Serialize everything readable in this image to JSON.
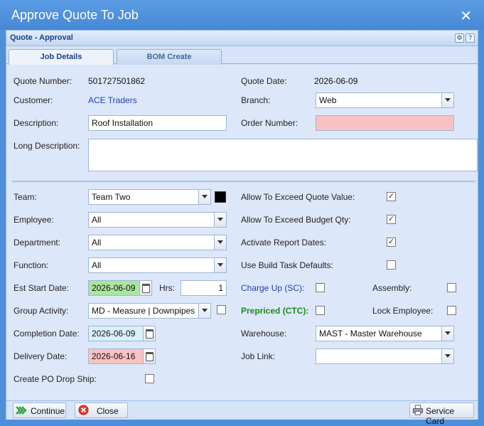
{
  "window": {
    "title": "Approve Quote To Job"
  },
  "panel": {
    "title": "Quote - Approval"
  },
  "tabs": [
    {
      "label": "Job Details"
    },
    {
      "label": "BOM Create"
    }
  ],
  "form": {
    "quote_number_label": "Quote Number:",
    "quote_number": "501727501862",
    "quote_date_label": "Quote Date:",
    "quote_date": "2026-06-09",
    "customer_label": "Customer:",
    "customer": "ACE Traders",
    "branch_label": "Branch:",
    "branch": "Web",
    "description_label": "Description:",
    "description": "Roof Installation",
    "order_number_label": "Order Number:",
    "order_number": "",
    "long_description_label": "Long Description:",
    "long_description": "",
    "team_label": "Team:",
    "team": "Team Two",
    "employee_label": "Employee:",
    "employee": "All",
    "department_label": "Department:",
    "department": "All",
    "function_label": "Function:",
    "function": "All",
    "est_start_label": "Est Start Date:",
    "est_start": "2026-06-09",
    "hrs_label": "Hrs:",
    "hrs": "1",
    "group_activity_label": "Group Activity:",
    "group_activity": "MD - Measure | Downpipes",
    "completion_label": "Completion Date:",
    "completion": "2026-06-09",
    "delivery_label": "Delivery Date:",
    "delivery": "2026-06-16",
    "create_po_label": "Create PO Drop Ship:",
    "exceed_quote_label": "Allow To Exceed Quote Value:",
    "exceed_budget_label": "Allow To Exceed Budget Qty:",
    "activate_report_label": "Activate Report Dates:",
    "build_task_label": "Use Build Task Defaults:",
    "charge_up_label": "Charge Up (SC):",
    "assembly_label": "Assembly:",
    "prepriced_label": "Prepriced (CTC):",
    "lock_employee_label": "Lock Employee:",
    "warehouse_label": "Warehouse:",
    "warehouse": "MAST - Master Warehouse",
    "job_link_label": "Job Link:",
    "job_link": ""
  },
  "checks": {
    "check_mark": "✓",
    "exceed_quote": true,
    "exceed_budget": true,
    "activate_report": true,
    "build_task": false,
    "charge_up": false,
    "assembly": false,
    "prepriced": false,
    "lock_employee": false,
    "group_activity": false,
    "create_po": false
  },
  "footer": {
    "continue_label": "Continue",
    "close_label": "Close",
    "service_card_label": "Service Card"
  },
  "colors": {
    "title_bar": "#4d8fd9",
    "required_field": "#f9c2c2",
    "start_date_field": "#a9e6a0",
    "completion_field": "#d9f0fb",
    "team_color": "#000000"
  }
}
